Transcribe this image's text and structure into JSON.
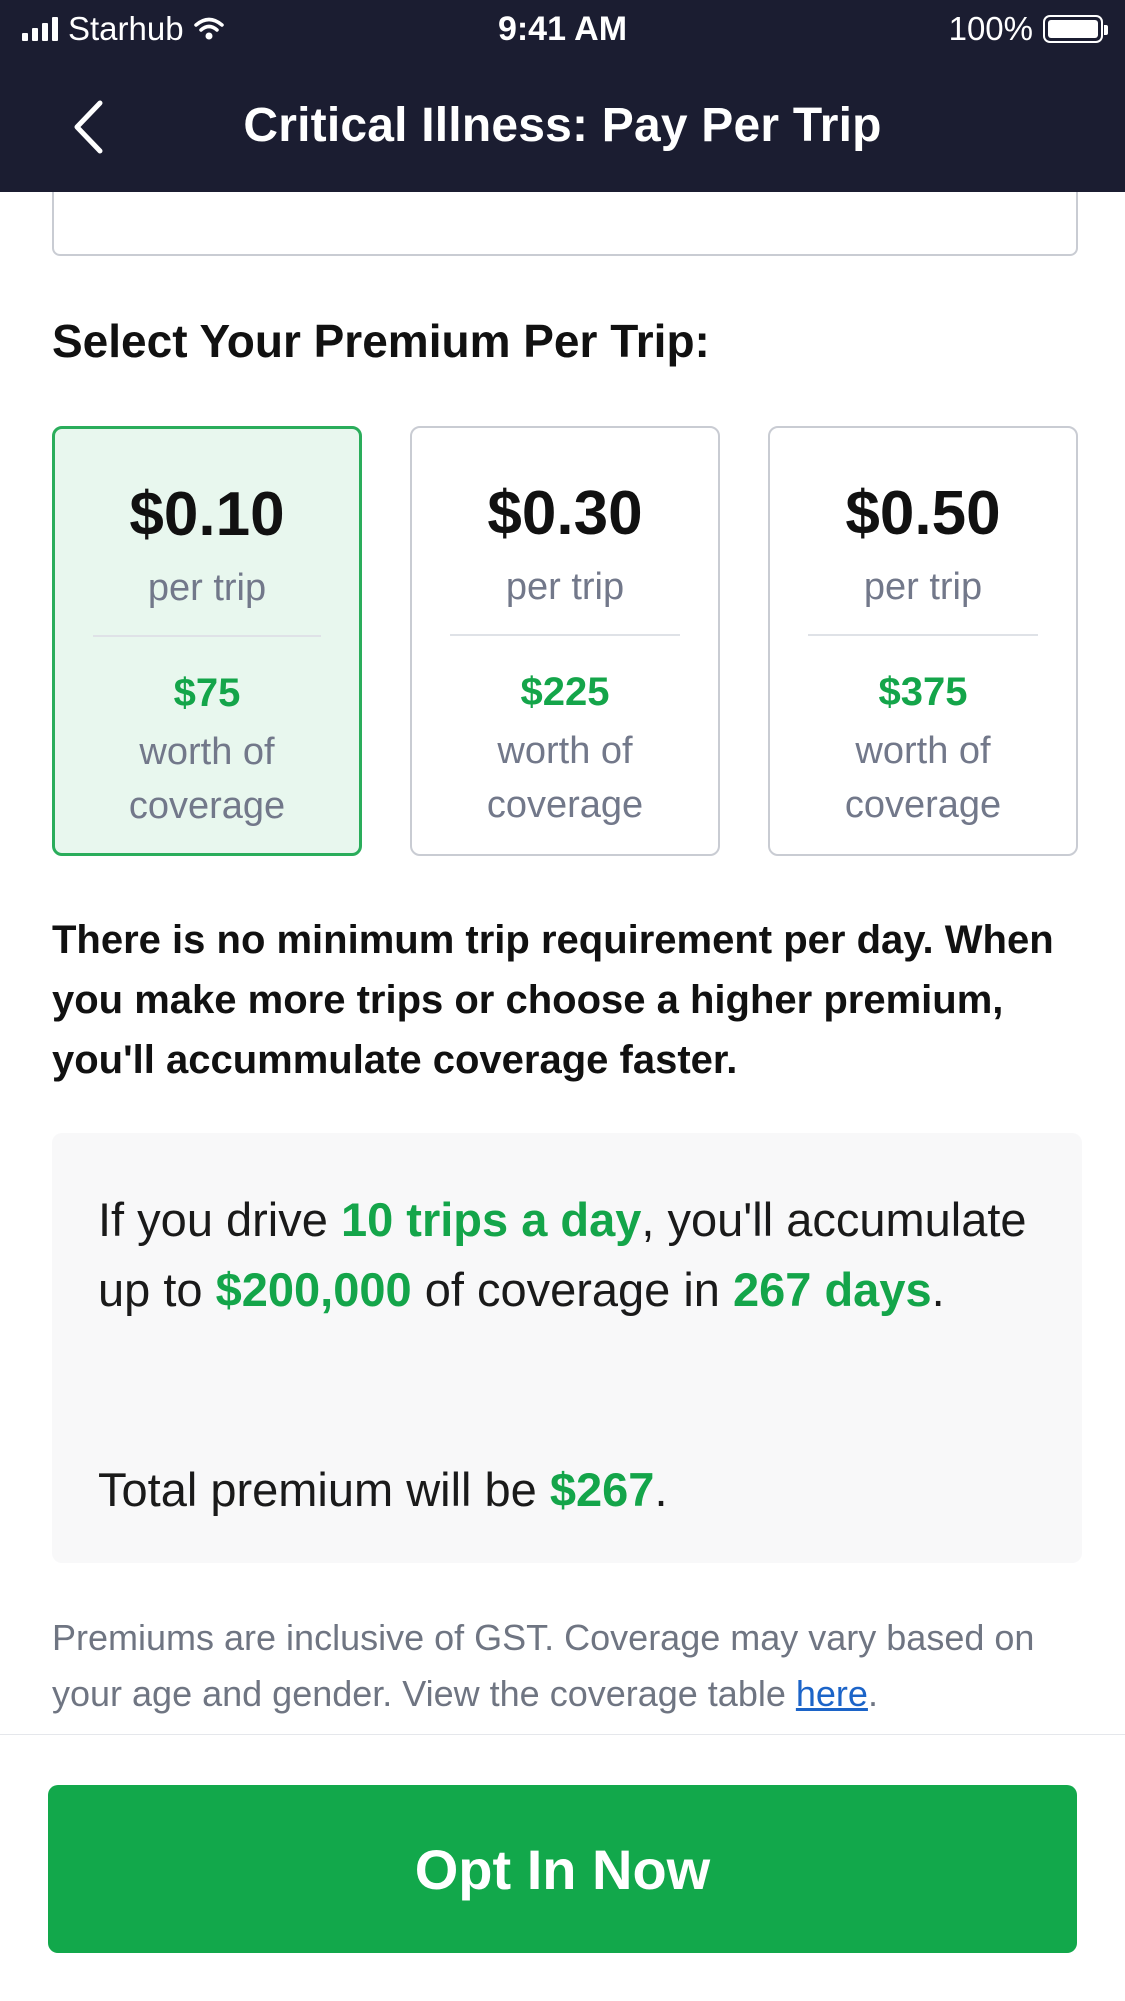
{
  "status_bar": {
    "carrier": "Starhub",
    "time": "9:41 AM",
    "battery": "100%"
  },
  "nav": {
    "title": "Critical Illness: Pay Per Trip"
  },
  "section": {
    "heading": "Select Your Premium Per Trip:"
  },
  "premiums": [
    {
      "price": "$0.10",
      "unit": "per trip",
      "coverage": "$75",
      "coverage_label": "worth of coverage",
      "selected": true
    },
    {
      "price": "$0.30",
      "unit": "per trip",
      "coverage": "$225",
      "coverage_label": "worth of coverage",
      "selected": false
    },
    {
      "price": "$0.50",
      "unit": "per trip",
      "coverage": "$375",
      "coverage_label": "worth of coverage",
      "selected": false
    }
  ],
  "info_text": "There is no minimum trip requirement per day. When you make more trips or choose a higher premium, you'll accummulate coverage faster.",
  "calculation": {
    "part1": "If you drive ",
    "trips": "10 trips a day",
    "part2": ", you'll accumulate up to ",
    "amount": "$200,000",
    "part3": " of coverage in ",
    "days": "267 days",
    "part4": ".",
    "total_prefix": "Total premium will be ",
    "total_amount": "$267",
    "total_suffix": "."
  },
  "disclaimer": {
    "text": "Premiums are inclusive of GST. Coverage may vary based on your age and gender. View the coverage table ",
    "link": "here",
    "suffix": "."
  },
  "cta": {
    "label": "Opt In Now"
  },
  "colors": {
    "header_bg": "#1b1d31",
    "accent_green": "#14a54a",
    "button_green": "#12a84b",
    "selected_bg": "#e8f7ee",
    "link_blue": "#1c64c8"
  },
  "icons": [
    "signal-icon",
    "wifi-icon",
    "battery-icon",
    "back-chevron-icon"
  ]
}
